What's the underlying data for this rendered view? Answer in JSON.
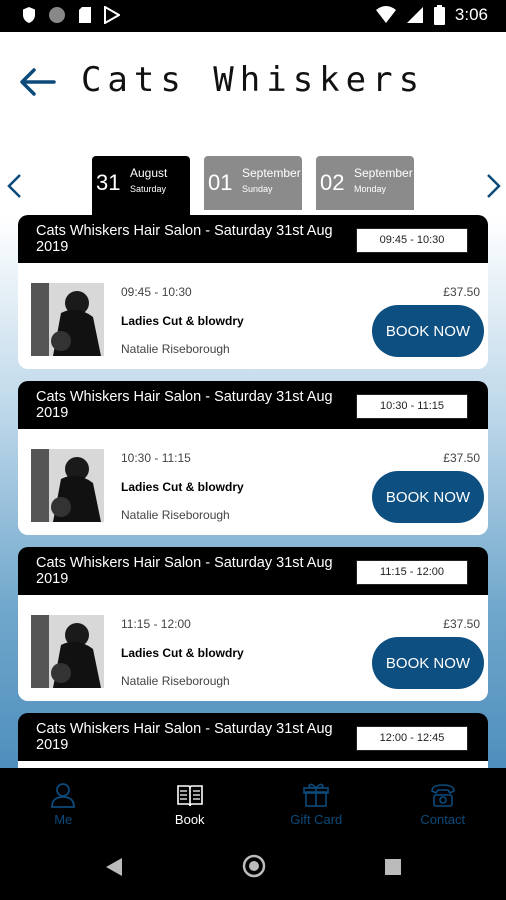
{
  "status_bar": {
    "time": "3:06"
  },
  "header": {
    "title": "Cats Whiskers"
  },
  "date_tabs": [
    {
      "day": "31",
      "month": "August",
      "weekday": "Saturday",
      "active": true
    },
    {
      "day": "01",
      "month": "September",
      "weekday": "Sunday",
      "active": false
    },
    {
      "day": "02",
      "month": "September",
      "weekday": "Monday",
      "active": false
    }
  ],
  "slots": [
    {
      "salon": "Cats Whiskers Hair Salon - Saturday 31st Aug 2019",
      "time_chip": "09:45 - 10:30",
      "time": "09:45 - 10:30",
      "service": "Ladies Cut & blowdry",
      "stylist": "Natalie Riseborough",
      "price": "£37.50",
      "button": "BOOK NOW"
    },
    {
      "salon": "Cats Whiskers Hair Salon - Saturday 31st Aug 2019",
      "time_chip": "10:30 - 11:15",
      "time": "10:30 - 11:15",
      "service": "Ladies Cut & blowdry",
      "stylist": "Natalie Riseborough",
      "price": "£37.50",
      "button": "BOOK NOW"
    },
    {
      "salon": "Cats Whiskers Hair Salon - Saturday 31st Aug 2019",
      "time_chip": "11:15 - 12:00",
      "time": "11:15 - 12:00",
      "service": "Ladies Cut & blowdry",
      "stylist": "Natalie Riseborough",
      "price": "£37.50",
      "button": "BOOK NOW"
    },
    {
      "salon": "Cats Whiskers Hair Salon - Saturday 31st Aug 2019",
      "time_chip": "12:00 - 12:45"
    }
  ],
  "bottom_nav": [
    {
      "label": "Me",
      "icon": "person-icon",
      "active": false
    },
    {
      "label": "Book",
      "icon": "book-icon",
      "active": true
    },
    {
      "label": "Gift Card",
      "icon": "gift-icon",
      "active": false
    },
    {
      "label": "Contact",
      "icon": "phone-icon",
      "active": false
    }
  ],
  "colors": {
    "accent": "#0d4f80",
    "tab_active": "#000000",
    "tab_inactive": "#8b8b8b"
  }
}
